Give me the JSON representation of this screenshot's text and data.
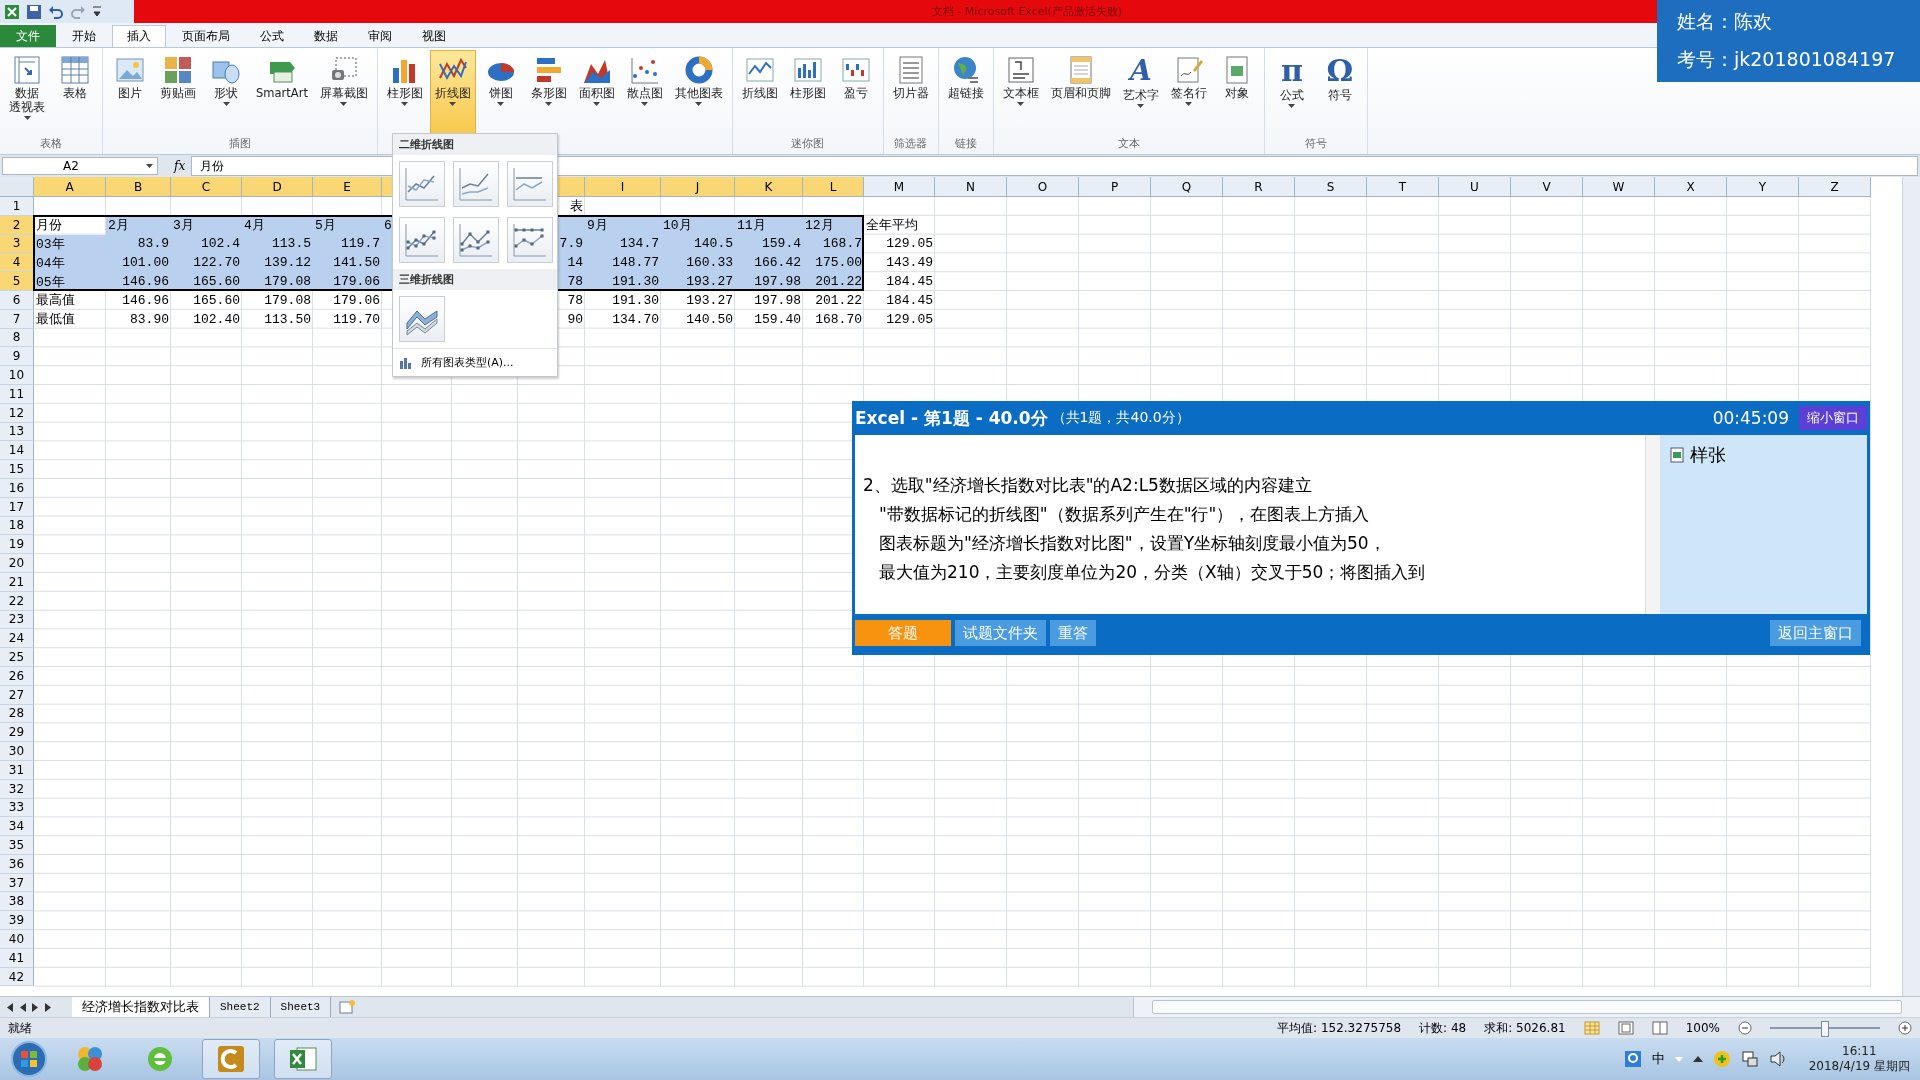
{
  "window": {
    "title": "文档 - Microsoft Excel(产品激活失败)"
  },
  "candidate": {
    "name_line": "姓名：陈欢",
    "id_line": "考号：jk201801084197"
  },
  "ribbon_tabs": [
    {
      "label": "文件",
      "kind": "file",
      "selected": false
    },
    {
      "label": "开始",
      "kind": "tab",
      "selected": false
    },
    {
      "label": "插入",
      "kind": "tab",
      "selected": true
    },
    {
      "label": "页面布局",
      "kind": "tab",
      "selected": false
    },
    {
      "label": "公式",
      "kind": "tab",
      "selected": false
    },
    {
      "label": "数据",
      "kind": "tab",
      "selected": false
    },
    {
      "label": "审阅",
      "kind": "tab",
      "selected": false
    },
    {
      "label": "视图",
      "kind": "tab",
      "selected": false
    }
  ],
  "ribbon_groups": [
    {
      "label": "表格",
      "buttons": [
        {
          "lines": [
            "数据",
            "透视表"
          ],
          "has_menu": true,
          "pressed": false
        },
        {
          "lines": [
            "表格"
          ],
          "has_menu": false,
          "pressed": false
        }
      ]
    },
    {
      "label": "插图",
      "buttons": [
        {
          "lines": [
            "图片"
          ],
          "has_menu": false,
          "pressed": false
        },
        {
          "lines": [
            "剪贴画"
          ],
          "has_menu": false,
          "pressed": false
        },
        {
          "lines": [
            "形状"
          ],
          "has_menu": true,
          "pressed": false
        },
        {
          "lines": [
            "SmartArt"
          ],
          "has_menu": false,
          "pressed": false
        },
        {
          "lines": [
            "屏幕截图"
          ],
          "has_menu": true,
          "pressed": false
        }
      ]
    },
    {
      "buttons": [
        {
          "lines": [
            "柱形图"
          ],
          "has_menu": true,
          "pressed": false
        },
        {
          "lines": [
            "折线图"
          ],
          "has_menu": true,
          "pressed": true
        },
        {
          "lines": [
            "饼图"
          ],
          "has_menu": true,
          "pressed": false
        },
        {
          "lines": [
            "条形图"
          ],
          "has_menu": true,
          "pressed": false
        },
        {
          "lines": [
            "面积图"
          ],
          "has_menu": true,
          "pressed": false
        },
        {
          "lines": [
            "散点图"
          ],
          "has_menu": true,
          "pressed": false
        },
        {
          "lines": [
            "其他图表"
          ],
          "has_menu": true,
          "pressed": false
        }
      ]
    },
    {
      "label": "迷你图",
      "buttons": [
        {
          "lines": [
            "折线图"
          ],
          "has_menu": false,
          "pressed": false
        },
        {
          "lines": [
            "柱形图"
          ],
          "has_menu": false,
          "pressed": false
        },
        {
          "lines": [
            "盈亏"
          ],
          "has_menu": false,
          "pressed": false
        }
      ]
    },
    {
      "label": "筛选器",
      "buttons": [
        {
          "lines": [
            "切片器"
          ],
          "has_menu": false,
          "pressed": false
        }
      ]
    },
    {
      "label": "链接",
      "buttons": [
        {
          "lines": [
            "超链接"
          ],
          "has_menu": false,
          "pressed": false
        }
      ]
    },
    {
      "label": "文本",
      "buttons": [
        {
          "lines": [
            "文本框"
          ],
          "has_menu": true,
          "pressed": false
        },
        {
          "lines": [
            "页眉和页脚"
          ],
          "has_menu": false,
          "pressed": false
        },
        {
          "lines": [
            "艺术字"
          ],
          "has_menu": true,
          "pressed": false,
          "glyph": "A"
        },
        {
          "lines": [
            "签名行"
          ],
          "has_menu": true,
          "pressed": false
        },
        {
          "lines": [
            "对象"
          ],
          "has_menu": false,
          "pressed": false
        }
      ]
    },
    {
      "label": "符号",
      "buttons": [
        {
          "lines": [
            "公式"
          ],
          "has_menu": true,
          "pressed": false,
          "glyph": "π"
        },
        {
          "lines": [
            "符号"
          ],
          "has_menu": false,
          "pressed": false,
          "glyph": "Ω"
        }
      ]
    }
  ],
  "formula_bar": {
    "name_box": "A2",
    "function_label": "fx",
    "formula": "月份"
  },
  "sheet": {
    "columns": [
      {
        "label": "A",
        "selected": true
      },
      {
        "label": "B",
        "selected": true
      },
      {
        "label": "C",
        "selected": true
      },
      {
        "label": "D",
        "selected": true
      },
      {
        "label": "E",
        "selected": true
      },
      {
        "selected": true
      },
      {},
      {
        "selected": true
      },
      {
        "label": "I",
        "selected": true
      },
      {
        "label": "J",
        "selected": true
      },
      {
        "label": "K",
        "selected": true
      },
      {
        "label": "L",
        "selected": true
      },
      {
        "label": "M",
        "selected": false
      },
      {
        "label": "N",
        "selected": false
      },
      {
        "label": "O",
        "selected": false
      },
      {
        "label": "P",
        "selected": false
      },
      {
        "label": "Q",
        "selected": false
      },
      {
        "label": "R",
        "selected": false
      },
      {
        "label": "S",
        "selected": false
      },
      {
        "label": "T",
        "selected": false
      },
      {
        "label": "U",
        "selected": false
      },
      {
        "label": "V",
        "selected": false
      },
      {
        "label": "W",
        "selected": false
      },
      {
        "label": "X",
        "selected": false
      },
      {
        "label": "Y",
        "selected": false
      },
      {
        "label": "Z",
        "selected": false
      }
    ],
    "rows": [
      {
        "number": "1",
        "selected": false,
        "kind": "title",
        "cells": [
          null,
          null,
          null,
          null,
          null,
          null,
          null,
          "表"
        ]
      },
      {
        "number": "2",
        "selected": true,
        "kind": "header",
        "cells": [
          {
            "text": "月份",
            "active": true
          },
          "2月",
          "3月",
          "4月",
          "5月",
          "6",
          null,
          null,
          "9月",
          "10月",
          "11月",
          "12月",
          "全年平均"
        ]
      },
      {
        "number": "3",
        "selected": true,
        "kind": "data",
        "cells": [
          "03年",
          "83.9",
          "102.4",
          "113.5",
          "119.7",
          null,
          null,
          "7.9",
          "134.7",
          "140.5",
          "159.4",
          "168.7",
          "129.05"
        ]
      },
      {
        "number": "4",
        "selected": true,
        "kind": "data",
        "cells": [
          "04年",
          "101.00",
          "122.70",
          "139.12",
          "141.50",
          null,
          null,
          "14",
          "148.77",
          "160.33",
          "166.42",
          "175.00",
          "143.49"
        ]
      },
      {
        "number": "5",
        "selected": true,
        "kind": "data",
        "cells": [
          "05年",
          "146.96",
          "165.60",
          "179.08",
          "179.06",
          null,
          null,
          "78",
          "191.30",
          "193.27",
          "197.98",
          "201.22",
          "184.45"
        ]
      },
      {
        "number": "6",
        "selected": false,
        "kind": "data",
        "cells": [
          "最高值",
          "146.96",
          "165.60",
          "179.08",
          "179.06",
          null,
          null,
          "78",
          "191.30",
          "193.27",
          "197.98",
          "201.22",
          "184.45"
        ]
      },
      {
        "number": "7",
        "selected": false,
        "kind": "data",
        "cells": [
          "最低值",
          "83.90",
          "102.40",
          "113.50",
          "119.70",
          null,
          null,
          "90",
          "134.70",
          "140.50",
          "159.40",
          "168.70",
          "129.05"
        ]
      },
      {
        "number": "8",
        "selected": false
      },
      {
        "number": "9",
        "selected": false
      },
      {
        "number": "10",
        "selected": false
      },
      {
        "number": "11",
        "selected": false
      },
      {
        "number": "12",
        "selected": false
      },
      {
        "number": "13",
        "selected": false
      },
      {
        "number": "14",
        "selected": false
      },
      {
        "number": "15",
        "selected": false
      },
      {
        "number": "16",
        "selected": false
      },
      {
        "number": "17",
        "selected": false
      },
      {
        "number": "18",
        "selected": false
      },
      {
        "number": "19",
        "selected": false
      },
      {
        "number": "20",
        "selected": false
      },
      {
        "number": "21",
        "selected": false
      },
      {
        "number": "22",
        "selected": false
      },
      {
        "number": "23",
        "selected": false
      },
      {
        "number": "24",
        "selected": false
      },
      {
        "number": "25",
        "selected": false
      },
      {
        "number": "26",
        "selected": false
      },
      {
        "number": "27",
        "selected": false
      },
      {
        "number": "28",
        "selected": false
      },
      {
        "number": "29",
        "selected": false
      },
      {
        "number": "30",
        "selected": false
      },
      {
        "number": "31",
        "selected": false
      },
      {
        "number": "32",
        "selected": false
      },
      {
        "number": "33",
        "selected": false
      },
      {
        "number": "34",
        "selected": false
      },
      {
        "number": "35",
        "selected": false
      },
      {
        "number": "36",
        "selected": false
      },
      {
        "number": "37",
        "selected": false
      },
      {
        "number": "38",
        "selected": false
      },
      {
        "number": "39",
        "selected": false
      },
      {
        "number": "40",
        "selected": false
      },
      {
        "number": "41",
        "selected": false
      },
      {
        "number": "42",
        "selected": false
      }
    ]
  },
  "chart_menu": {
    "sections": [
      {
        "title": "二维折线图",
        "items": [
          {
            "kind": "line"
          },
          {
            "kind": "stacked"
          },
          {
            "kind": "percent"
          },
          {
            "kind": "line-markers"
          },
          {
            "kind": "stacked-markers"
          },
          {
            "kind": "percent-markers"
          }
        ]
      },
      {
        "title": "三维折线图",
        "items": [
          {
            "kind": "perspective"
          }
        ]
      }
    ],
    "footer": "所有图表类型(A)..."
  },
  "task_panel": {
    "title": "Excel - 第1题 - 40.0分",
    "subtitle": "（共1题，共40.0分）",
    "timer": "00:45:09",
    "shrink_button": "缩小窗口",
    "question_lines": [
      "2、选取\"经济增长指数对比表\"的A2:L5数据区域的内容建立",
      "\"带数据标记的折线图\"（数据系列产生在\"行\"），在图表上方插入",
      "图表标题为\"经济增长指数对比图\"，设置Y坐标轴刻度最小值为50，",
      "最大值为210，主要刻度单位为20，分类（X轴）交叉于50；将图插入到"
    ],
    "attachment": "样张",
    "buttons": [
      {
        "label": "答题",
        "selected": true
      },
      {
        "label": "试题文件夹",
        "selected": false
      },
      {
        "label": "重答",
        "selected": false
      }
    ],
    "return_button": "返回主窗口"
  },
  "sheet_tabs": [
    {
      "label": "经济增长指数对比表",
      "selected": true
    },
    {
      "label": "Sheet2",
      "selected": false
    },
    {
      "label": "Sheet3",
      "selected": false
    }
  ],
  "status_bar": {
    "ready": "就绪",
    "average": "平均值: 152.3275758",
    "count": "计数: 48",
    "sum": "求和: 5026.81",
    "zoom": "100%",
    "level": 0.5
  },
  "taskbar": {
    "apps": [
      {
        "kind": "palette",
        "running": false
      },
      {
        "kind": "browser",
        "running": false
      },
      {
        "kind": "orange-app",
        "running": true
      },
      {
        "kind": "spreadsheet",
        "running": true
      }
    ],
    "ime": "中",
    "time": "16:11",
    "date": "2018/4/19 星期四"
  }
}
